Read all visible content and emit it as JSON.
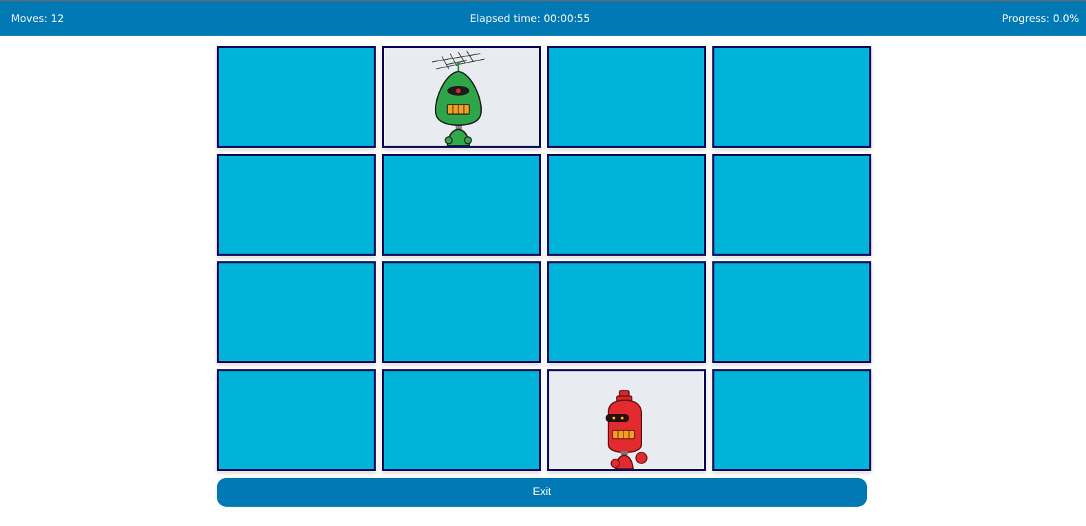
{
  "status": {
    "moves": "Moves: 12",
    "elapsed": "Elapsed time: 00:00:55",
    "progress": "Progress: 0.0%"
  },
  "board": {
    "rows": 4,
    "cols": 4,
    "cards": [
      {
        "state": "face-down"
      },
      {
        "state": "face-up",
        "image": "green-robot-icon"
      },
      {
        "state": "face-down"
      },
      {
        "state": "face-down"
      },
      {
        "state": "face-down"
      },
      {
        "state": "face-down"
      },
      {
        "state": "face-down"
      },
      {
        "state": "face-down"
      },
      {
        "state": "face-down"
      },
      {
        "state": "face-down"
      },
      {
        "state": "face-down"
      },
      {
        "state": "face-down"
      },
      {
        "state": "face-down"
      },
      {
        "state": "face-down"
      },
      {
        "state": "face-up",
        "image": "red-robot-icon"
      },
      {
        "state": "face-down"
      }
    ]
  },
  "actions": {
    "exit_label": "Exit"
  },
  "colors": {
    "header_bg": "#0079b5",
    "card_back": "#00b3d9",
    "card_border": "#14105e",
    "card_face": "#e8ebef"
  }
}
